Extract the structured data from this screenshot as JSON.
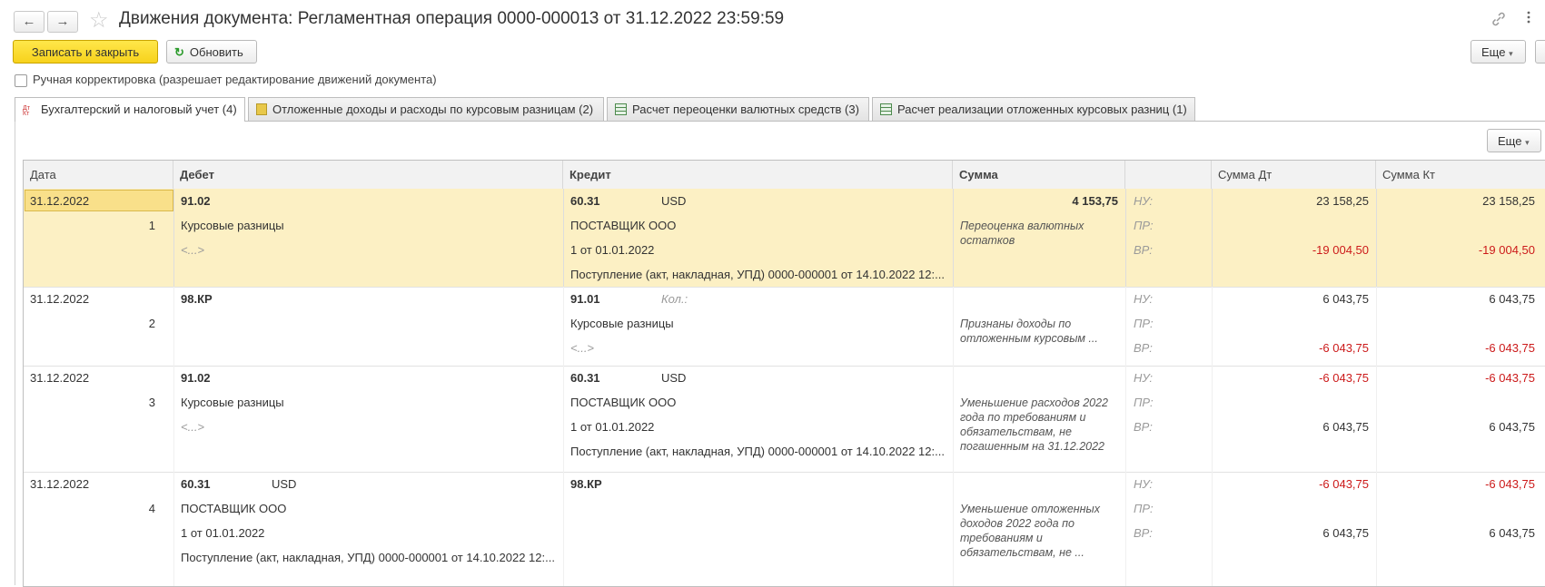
{
  "window": {
    "title": "Движения документа: Регламентная операция 0000-000013 от 31.12.2022 23:59:59",
    "nav_back": "←",
    "nav_forward": "→",
    "favorite_icon": "☆"
  },
  "toolbar": {
    "save_close": "Записать и закрыть",
    "refresh": "Обновить",
    "more": "Еще",
    "more_arrow": "▾"
  },
  "manual_correction": {
    "label": "Ручная корректировка (разрешает редактирование движений документа)",
    "checked": false
  },
  "tabs": [
    {
      "label": "Бухгалтерский и налоговый учет (4)",
      "active": true
    },
    {
      "label": "Отложенные доходы и расходы по курсовым разницам (2)",
      "active": false
    },
    {
      "label": "Расчет переоценки валютных средств (3)",
      "active": false
    },
    {
      "label": "Расчет реализации отложенных курсовых разниц (1)",
      "active": false
    }
  ],
  "grid_toolbar": {
    "more": "Еще"
  },
  "grid": {
    "columns": [
      "Дата",
      "Дебет",
      "Кредит",
      "Сумма",
      "",
      "Сумма Дт",
      "Сумма Кт"
    ],
    "rows": [
      {
        "date": "31.12.2022",
        "num": "1",
        "debit": {
          "account": "91.02",
          "sub1": "Курсовые разницы",
          "sub2": "<...>",
          "sub3": "",
          "extra": ""
        },
        "credit": {
          "account": "60.31",
          "extra": "USD",
          "sub1": "ПОСТАВЩИК ООО",
          "sub2": "1 от 01.01.2022",
          "sub3": "Поступление (акт, накладная, УПД) 0000-000001 от 14.10.2022 12:..."
        },
        "sum": "4 153,75",
        "comment": "Переоценка валютных остатков",
        "labels": [
          "НУ:",
          "ПР:",
          "ВР:"
        ],
        "sum_dt": [
          "23 158,25",
          "",
          "-19 004,50"
        ],
        "sum_kt": [
          "23 158,25",
          "",
          "-19 004,50"
        ]
      },
      {
        "date": "31.12.2022",
        "num": "2",
        "debit": {
          "account": "98.КР",
          "sub1": "",
          "sub2": "",
          "sub3": "",
          "extra": ""
        },
        "credit": {
          "account": "91.01",
          "extra": "Кол.:",
          "sub1": "Курсовые разницы",
          "sub2": "<...>",
          "sub3": ""
        },
        "sum": "",
        "comment": "Признаны доходы по отложенным курсовым ...",
        "labels": [
          "НУ:",
          "ПР:",
          "ВР:"
        ],
        "sum_dt": [
          "6 043,75",
          "",
          "-6 043,75"
        ],
        "sum_kt": [
          "6 043,75",
          "",
          "-6 043,75"
        ]
      },
      {
        "date": "31.12.2022",
        "num": "3",
        "debit": {
          "account": "91.02",
          "sub1": "Курсовые разницы",
          "sub2": "<...>",
          "sub3": "",
          "extra": ""
        },
        "credit": {
          "account": "60.31",
          "extra": "USD",
          "sub1": "ПОСТАВЩИК ООО",
          "sub2": "1 от 01.01.2022",
          "sub3": "Поступление (акт, накладная, УПД) 0000-000001 от 14.10.2022 12:..."
        },
        "sum": "",
        "comment": "Уменьшение расходов 2022 года по требованиям и обязательствам, не погашенным на 31.12.2022",
        "labels": [
          "НУ:",
          "ПР:",
          "ВР:"
        ],
        "sum_dt": [
          "-6 043,75",
          "",
          "6 043,75"
        ],
        "sum_kt": [
          "-6 043,75",
          "",
          "6 043,75"
        ]
      },
      {
        "date": "31.12.2022",
        "num": "4",
        "debit": {
          "account": "60.31",
          "extra": "USD",
          "sub1": "ПОСТАВЩИК ООО",
          "sub2": "1 от 01.01.2022",
          "sub3": "Поступление (акт, накладная, УПД) 0000-000001 от 14.10.2022 12:..."
        },
        "credit": {
          "account": "98.КР",
          "extra": "",
          "sub1": "",
          "sub2": "",
          "sub3": ""
        },
        "sum": "",
        "comment": "Уменьшение отложенных доходов 2022 года по требованиям и обязательствам, не ...",
        "labels": [
          "НУ:",
          "ПР:",
          "ВР:"
        ],
        "sum_dt": [
          "-6 043,75",
          "",
          "6 043,75"
        ],
        "sum_kt": [
          "-6 043,75",
          "",
          "6 043,75"
        ]
      }
    ]
  }
}
